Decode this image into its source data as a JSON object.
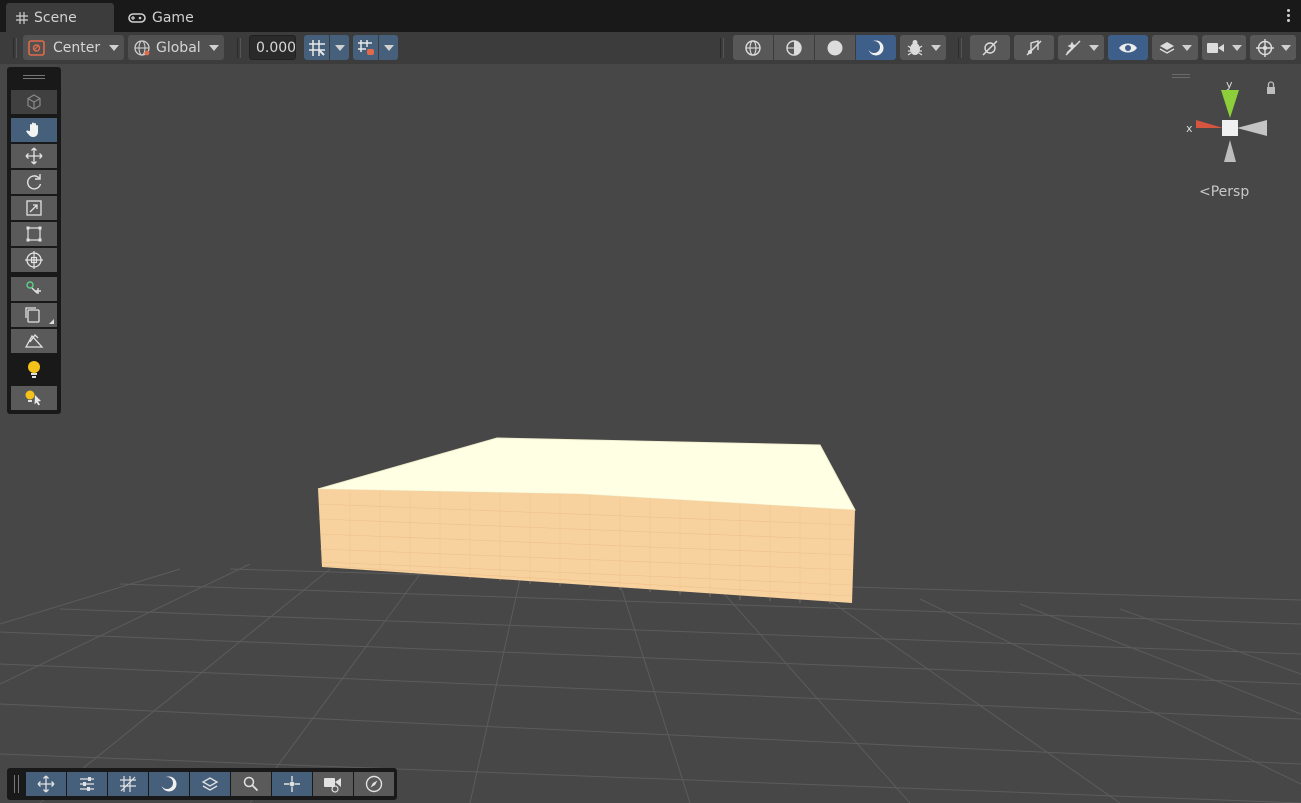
{
  "tabs": [
    {
      "label": "Scene",
      "icon": "grid-icon",
      "active": true
    },
    {
      "label": "Game",
      "icon": "gamepad-icon",
      "active": false
    }
  ],
  "toolbar": {
    "pivot_mode": "Center",
    "pivot_rotation": "Global",
    "snap_increment": "0.000"
  },
  "gizmo": {
    "x_label": "x",
    "y_label": "y",
    "projection_label": "Persp",
    "colors": {
      "x": "#d6553f",
      "y": "#8ccf3a",
      "other": "#c8c8c8"
    }
  },
  "scene": {
    "object": "box",
    "top_color": "#ffffe6",
    "side_color": "#f7d09b",
    "background": "#474747",
    "grid_color": "#5e5e5e"
  },
  "left_tools": [
    {
      "name": "view-tool",
      "icon": "hand-icon",
      "selected": true
    },
    {
      "name": "move-tool",
      "icon": "move-arrows-icon"
    },
    {
      "name": "rotate-tool",
      "icon": "rotate-icon"
    },
    {
      "name": "scale-tool",
      "icon": "scale-icon"
    },
    {
      "name": "rect-tool",
      "icon": "rect-transform-icon"
    },
    {
      "name": "transform-tool",
      "icon": "transform-icon"
    }
  ],
  "bottom_tools": [
    "move-arrows-icon",
    "sliders-icon",
    "grid-snap-icon",
    "shading-icon",
    "layers-icon",
    "search-icon",
    "pivot-icon",
    "camera-icon",
    "compass-icon"
  ]
}
